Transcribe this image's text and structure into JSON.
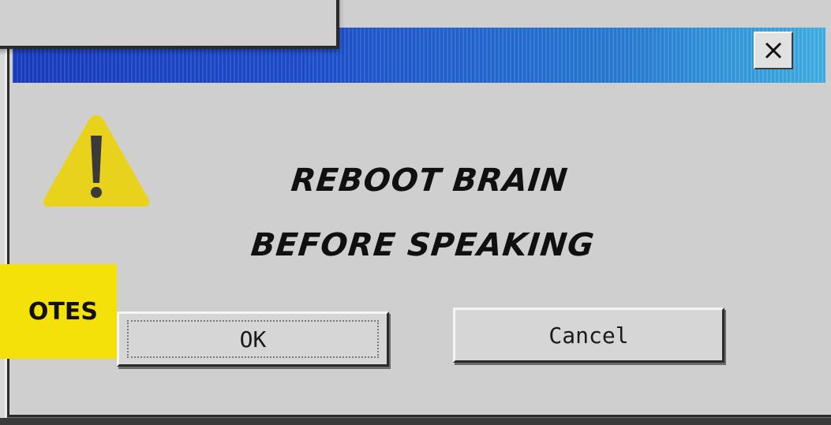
{
  "dialog": {
    "message_lines": [
      "REBOOT BRAIN",
      "BEFORE SPEAKING"
    ],
    "icon": "warning-icon",
    "close_icon": "close-icon",
    "close_glyph": "×"
  },
  "buttons": {
    "ok_label": "OK",
    "cancel_label": "Cancel"
  },
  "badge": {
    "text": "OTES"
  },
  "colors": {
    "title_bar_start": "#1b3ec4",
    "title_bar_end": "#43b4e8",
    "warning_yellow": "#e8d21c",
    "badge_yellow": "#f4e10a",
    "window_gray": "#cfcfcf"
  }
}
